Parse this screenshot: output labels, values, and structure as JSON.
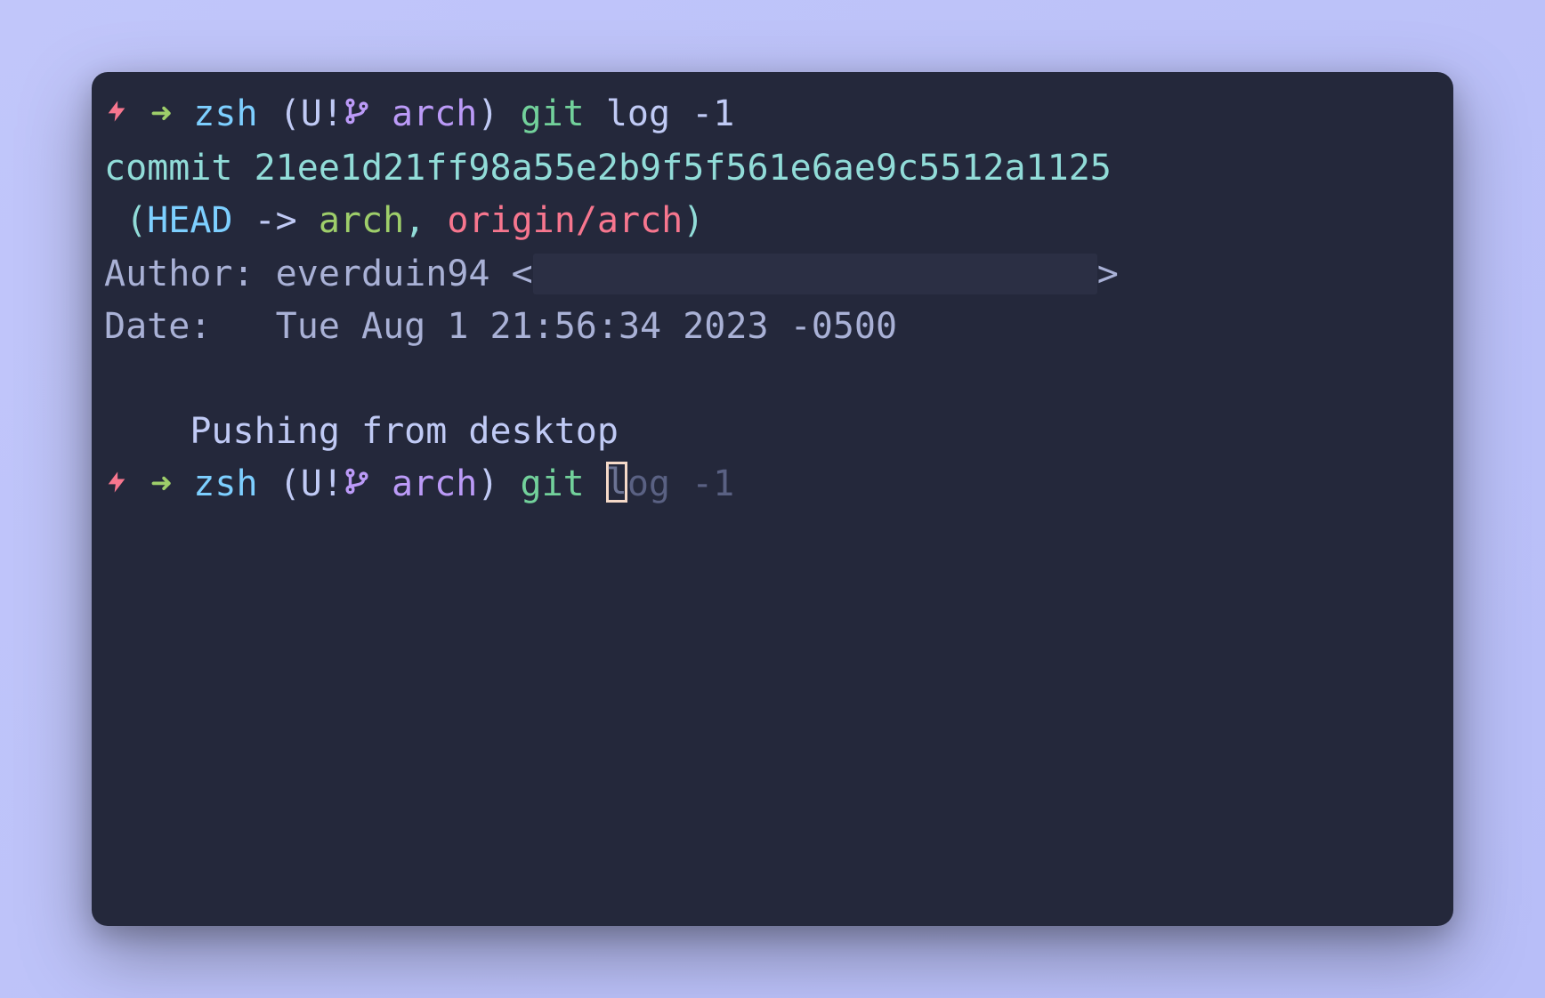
{
  "prompt1": {
    "shell": "zsh",
    "status_open": "(",
    "status_flags": "U!",
    "branch": "arch",
    "status_close": ")",
    "command_git": "git",
    "command_args": "log -1"
  },
  "output": {
    "commit_label": "commit ",
    "commit_hash": "21ee1d21ff98a55e2b9f5f561e6ae9c5512a1125",
    "refs_open": " (",
    "head": "HEAD",
    "arrow": " -> ",
    "local_branch": "arch",
    "comma": ", ",
    "remote_branch": "origin/arch",
    "refs_close": ")",
    "author_label": "Author: ",
    "author_name": "everduin94",
    "author_open": " <",
    "author_email_hidden": "                          ",
    "author_close": ">",
    "date_label": "Date:   ",
    "date_value": "Tue Aug 1 21:56:34 2023 -0500",
    "message_indent": "    ",
    "message": "Pushing from desktop"
  },
  "prompt2": {
    "shell": "zsh",
    "status_open": "(",
    "status_flags": "U!",
    "branch": "arch",
    "status_close": ")",
    "command_git": "git",
    "typed": " ",
    "cursor_char": "l",
    "ghost_suggestion": "og -1"
  }
}
